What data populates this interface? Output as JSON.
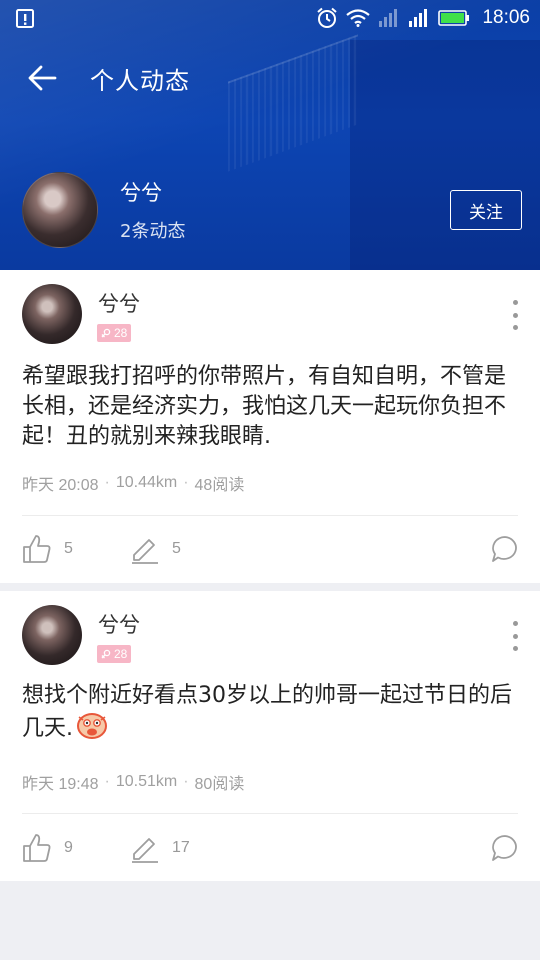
{
  "status_bar": {
    "time": "18:06",
    "icons": [
      "notification-icon",
      "alarm-icon",
      "wifi-icon",
      "signal-weak-icon",
      "signal-icon",
      "battery-icon"
    ]
  },
  "header": {
    "title": "个人动态",
    "back_icon": "arrow-left-icon",
    "bg_color": "#0d45b3"
  },
  "profile": {
    "name": "兮兮",
    "post_count": "2条动态",
    "follow_label": "关注"
  },
  "posts": [
    {
      "user": "兮兮",
      "level": "28",
      "text": "希望跟我打招呼的你带照片，有自知自明，不管是长相，还是经济实力，我怕这几天一起玩你负担不起！丑的就别来辣我眼睛.",
      "time": "昨天 20:08",
      "distance": "10.44km",
      "reads": "48阅读",
      "likes": "5",
      "edits": "5"
    },
    {
      "user": "兮兮",
      "level": "28",
      "text": "想找个附近好看点30岁以上的帅哥一起过节日的后几天.",
      "time": "昨天 19:48",
      "distance": "10.51km",
      "reads": "80阅读",
      "likes": "9",
      "edits": "17"
    }
  ],
  "colors": {
    "badge_pink": "#f7b6c6",
    "meta_gray": "#a0a0a0",
    "page_bg": "#eeeff3"
  }
}
